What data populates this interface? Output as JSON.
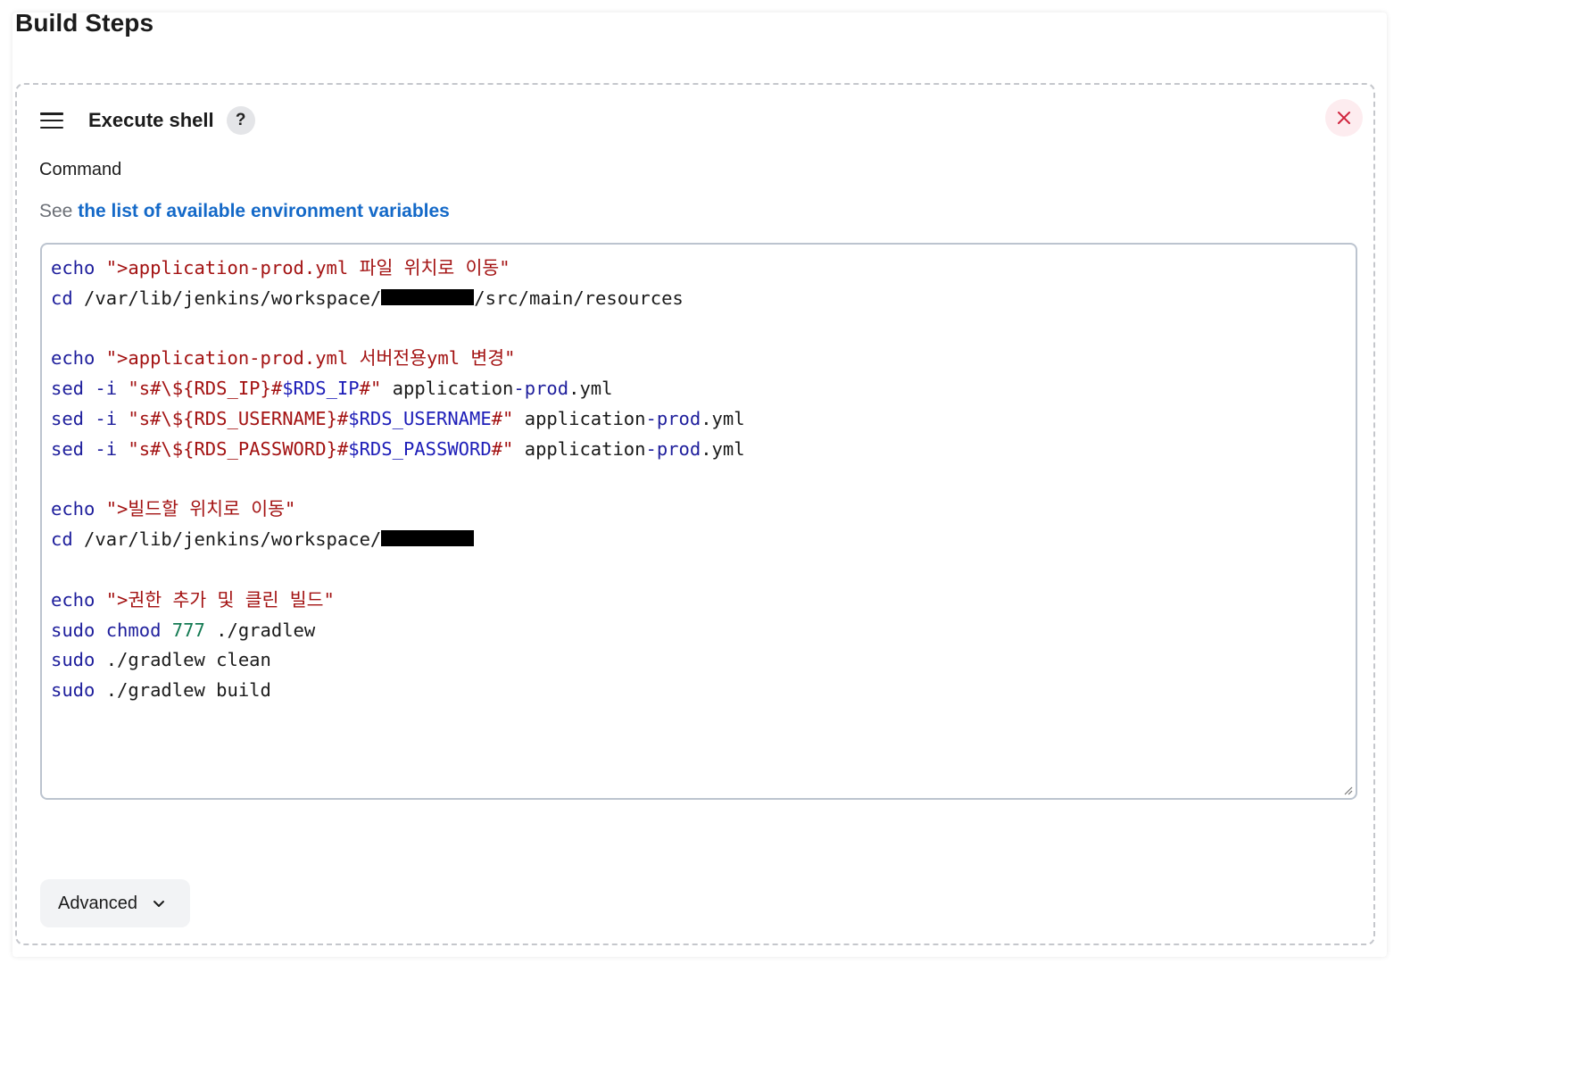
{
  "section": {
    "title": "Build Steps"
  },
  "step": {
    "title": "Execute shell",
    "help_label": "?",
    "command_label": "Command",
    "see_prefix": "See",
    "env_link_text": "the list of available environment variables",
    "advanced_label": "Advanced",
    "command_lines": [
      "echo \">application-prod.yml 파일 위치로 이동\"",
      "cd /var/lib/jenkins/workspace/[redacted]/src/main/resources",
      "",
      "echo \">application-prod.yml 서버전용yml 변경\"",
      "sed -i \"s#\\${RDS_IP}#$RDS_IP#\" application-prod.yml",
      "sed -i \"s#\\${RDS_USERNAME}#$RDS_USERNAME#\" application-prod.yml",
      "sed -i \"s#\\${RDS_PASSWORD}#$RDS_PASSWORD#\" application-prod.yml",
      "",
      "echo \">빌드할 위치로 이동\"",
      "cd /var/lib/jenkins/workspace/[redacted]",
      "",
      "echo \">권한 추가 및 클린 빌드\"",
      "sudo chmod 777 ./gradlew",
      "sudo ./gradlew clean",
      "sudo ./gradlew build"
    ]
  },
  "colors": {
    "keyword": "#1e1e9c",
    "string": "#a31212",
    "number": "#137a52",
    "link": "#1469c8",
    "close_bg": "#fdecef",
    "close_icon": "#d0243d"
  },
  "icons": {
    "drag": "drag-handle-icon",
    "help": "help-icon",
    "close": "close-icon",
    "advanced_chevron": "chevron-down-icon",
    "resize": "resize-grip-icon"
  }
}
